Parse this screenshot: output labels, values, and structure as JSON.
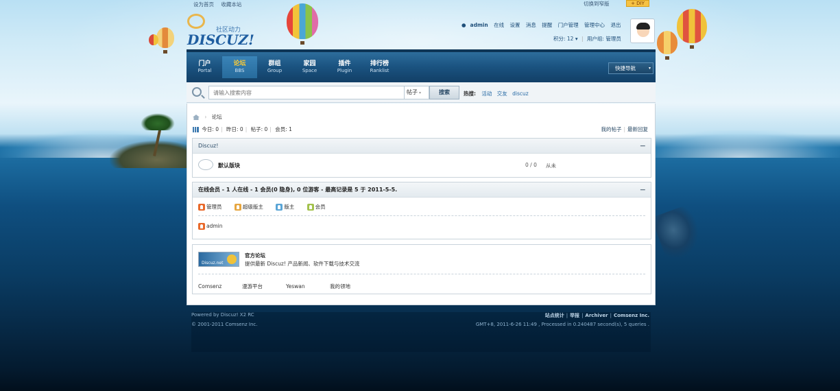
{
  "top_links": [
    "设为首页",
    "收藏本站"
  ],
  "switch_style": "切换到窄版",
  "diy_button": "DIY",
  "logo": {
    "text": "DISCUZ!",
    "subtitle": "社区动力"
  },
  "user": {
    "name": "admin",
    "online_label": "在线",
    "links": [
      "设置",
      "消息",
      "提醒",
      "门户管理",
      "管理中心",
      "退出"
    ],
    "points": "积分: 12",
    "user_group": "用户组: 管理员"
  },
  "nav": {
    "items": [
      {
        "cn": "门户",
        "en": "Portal"
      },
      {
        "cn": "论坛",
        "en": "BBS"
      },
      {
        "cn": "群组",
        "en": "Group"
      },
      {
        "cn": "家园",
        "en": "Space"
      },
      {
        "cn": "插件",
        "en": "Plugin"
      },
      {
        "cn": "排行榜",
        "en": "Ranklist"
      }
    ],
    "active": "BBS",
    "quick_nav": "快捷导航"
  },
  "search": {
    "placeholder": "请输入搜索内容",
    "type": "帖子",
    "button": "搜索",
    "hot_label": "热搜:",
    "hot_words": [
      "活动",
      "交友",
      "discuz"
    ]
  },
  "breadcrumb": {
    "current": "论坛"
  },
  "stats": {
    "today": "今日: 0",
    "yesterday": "昨日: 0",
    "posts": "帖子: 0",
    "members": "会员: 1"
  },
  "right_links": [
    "我的帖子",
    "最新回复"
  ],
  "category": {
    "title": "Discuz!",
    "forum_name": "默认版块",
    "counts": "0 / 0",
    "last_post": "从未"
  },
  "online": {
    "title": "在线会员 - 1 人在线 - 1 会员(0 隐身), 0 位游客 - 最高记录是 5 于 2011-5-5.",
    "legend": [
      {
        "label": "管理员",
        "color": "#e8692b"
      },
      {
        "label": "超级版主",
        "color": "#e6a640"
      },
      {
        "label": "版主",
        "color": "#5aa5d6"
      },
      {
        "label": "会员",
        "color": "#a3c24d"
      }
    ],
    "users": [
      "admin"
    ]
  },
  "friend_links": {
    "logo_text": "Discuz.net",
    "title": "官方论坛",
    "desc": "提供最新 Discuz! 产品新闻、软件下载与技术交流",
    "items": [
      "Comsenz",
      "漫游平台",
      "Yeswan",
      "我的领地"
    ]
  },
  "footer": {
    "powered": "Powered by Discuz! X2 RC",
    "copyright": "© 2001-2011 Comsenz Inc.",
    "links": [
      "站点统计",
      "举报",
      "Archiver",
      "Comsenz Inc."
    ],
    "gmt": "GMT+8, 2011-6-26 11:49 , Processed in 0.240487 second(s), 5 queries ."
  }
}
